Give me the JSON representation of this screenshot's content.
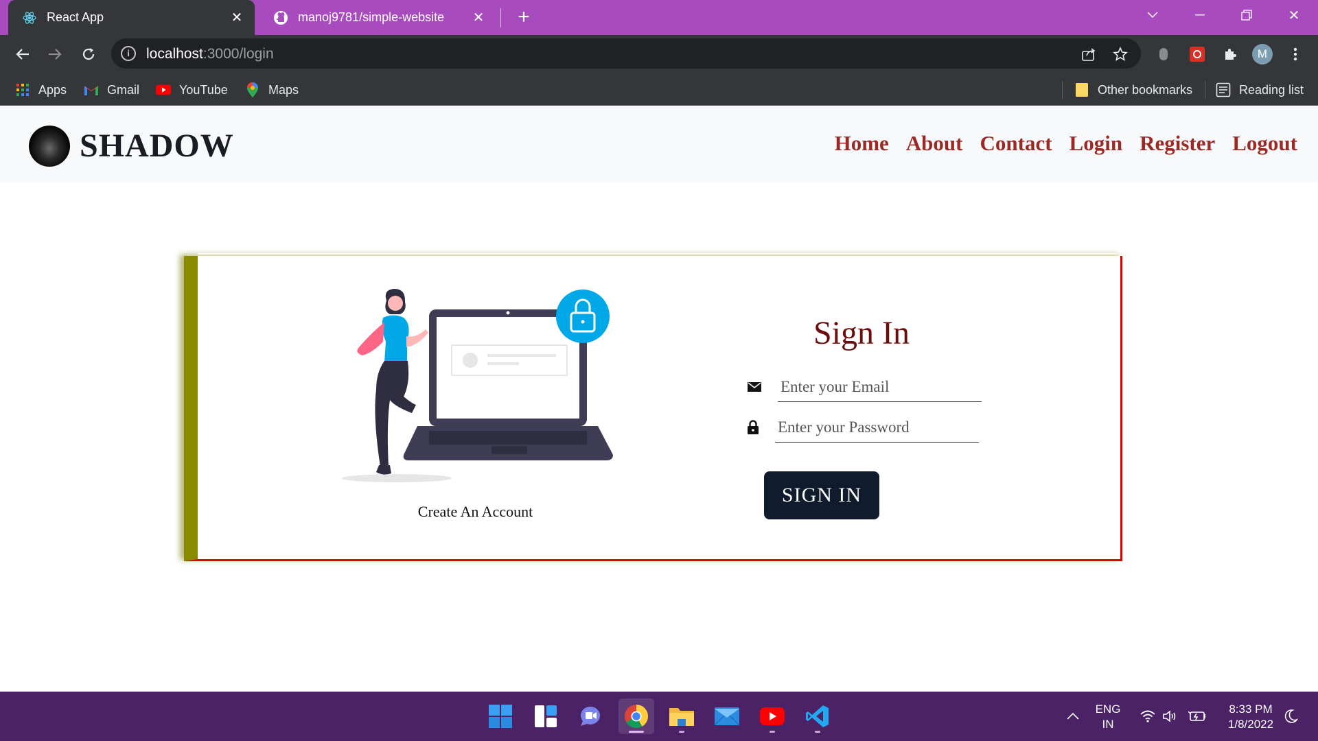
{
  "browser": {
    "tabs": [
      {
        "title": "React App",
        "favicon": "react-icon",
        "active": true
      },
      {
        "title": "manoj9781/simple-website",
        "favicon": "github-icon",
        "active": false
      }
    ],
    "address": {
      "host": "localhost",
      "path": ":3000/login"
    },
    "bookmarks": [
      {
        "label": "Apps",
        "icon": "apps-grid-icon"
      },
      {
        "label": "Gmail",
        "icon": "gmail-icon"
      },
      {
        "label": "YouTube",
        "icon": "youtube-icon"
      },
      {
        "label": "Maps",
        "icon": "maps-icon"
      }
    ],
    "other_bookmarks": "Other bookmarks",
    "reading_list": "Reading list",
    "profile_initial": "M"
  },
  "site": {
    "brand": "SHADOW",
    "nav": [
      "Home",
      "About",
      "Contact",
      "Login",
      "Register",
      "Logout"
    ]
  },
  "login": {
    "title": "Sign In",
    "email_placeholder": "Enter your Email",
    "password_placeholder": "Enter your Password",
    "button": "SIGN IN",
    "create_account": "Create An Account"
  },
  "taskbar": {
    "lang_line1": "ENG",
    "lang_line2": "IN",
    "time": "8:33 PM",
    "date": "1/8/2022"
  },
  "colors": {
    "tabstrip": "#a84bbf",
    "toolbar": "#35363a",
    "nav_link": "#9b2a27",
    "signin_title": "#6b0d0d",
    "card_left_border": "#8a8a00",
    "card_border": "#e00000",
    "button": "#101b2d",
    "taskbar": "#4a2265",
    "illustration_accent": "#00a8e8"
  }
}
